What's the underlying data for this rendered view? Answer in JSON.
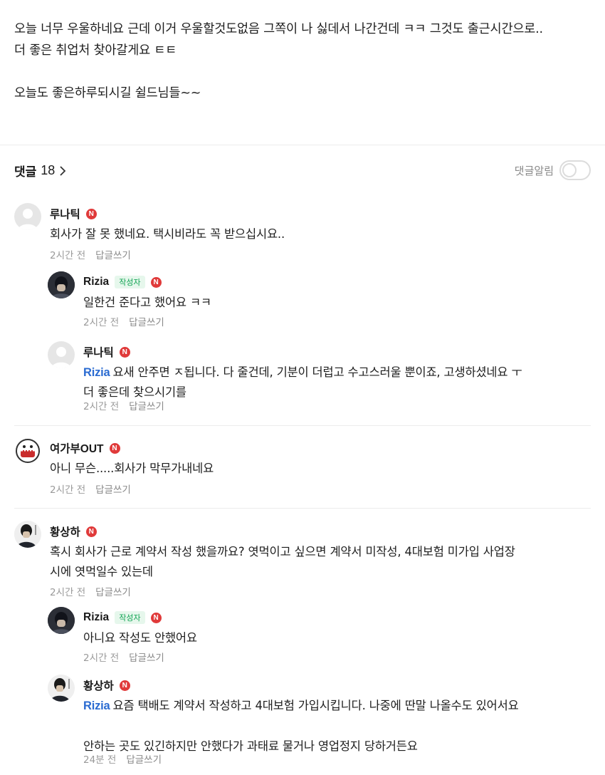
{
  "post": {
    "line1": "오늘 너무 우울하네요 근데 이거 우울할것도없음 그쪽이 나 싫데서 나간건데 ㅋㅋ 그것도 출근시간으로..",
    "line2": "더 좋은 취업처 찾아갈게요 ㅌㅌ",
    "line3": "오늘도 좋은하루되시길 쉴드님들~~"
  },
  "comments_header": {
    "label": "댓글",
    "count": "18",
    "notify_label": "댓글알림",
    "notify_on": false
  },
  "badges": {
    "writer": "작성자",
    "n": "N"
  },
  "comments": [
    {
      "nick": "루나틱",
      "text": "회사가 잘 못 했네요. 택시비라도 꼭 받으십시요..",
      "time": "2시간 전",
      "reply": "답글쓰기",
      "replies": [
        {
          "nick": "Rizia",
          "is_writer": true,
          "text": "일한건 준다고 했어요 ㅋㅋ",
          "time": "2시간 전",
          "reply": "답글쓰기"
        },
        {
          "nick": "루나틱",
          "mention": "Rizia",
          "text_line1": "요새 안주면 ㅈ됩니다. 다 줄건데, 기분이 더럽고 수고스러울 뿐이죠, 고생하셨네요 ㅜ",
          "text_line2": "더 좋은데 찾으시기를",
          "time": "2시간 전",
          "reply": "답글쓰기"
        }
      ]
    },
    {
      "nick": "여가부OUT",
      "text": "아니 무슨.....회사가 막무가내네요",
      "time": "2시간 전",
      "reply": "답글쓰기"
    },
    {
      "nick": "황상하",
      "text_line1": "혹시 회사가 근로 계약서 작성 했을까요? 엿먹이고 싶으면 계약서 미작성, 4대보험 미가입 사업장",
      "text_line2": "시에 엿먹일수 있는데",
      "time": "2시간 전",
      "reply": "답글쓰기",
      "replies": [
        {
          "nick": "Rizia",
          "is_writer": true,
          "text": "아니요 작성도 안했어요",
          "time": "2시간 전",
          "reply": "답글쓰기"
        },
        {
          "nick": "황상하",
          "mention": "Rizia",
          "text_line1": "요즘 택배도 계약서 작성하고 4대보험 가입시킵니다. 나중에 딴말 나올수도 있어서요",
          "text_line2": "안하는 곳도 있긴하지만 안했다가 과태료 물거나 영업정지 당하거든요",
          "time": "24분 전",
          "reply": "답글쓰기"
        }
      ]
    }
  ],
  "icons": {
    "chevron": "chevron-right-icon",
    "default_avatar": "default-avatar-icon"
  },
  "colors": {
    "mention": "#2a6bd1",
    "n_badge": "#e03a3a",
    "writer_badge": "#12a454"
  }
}
